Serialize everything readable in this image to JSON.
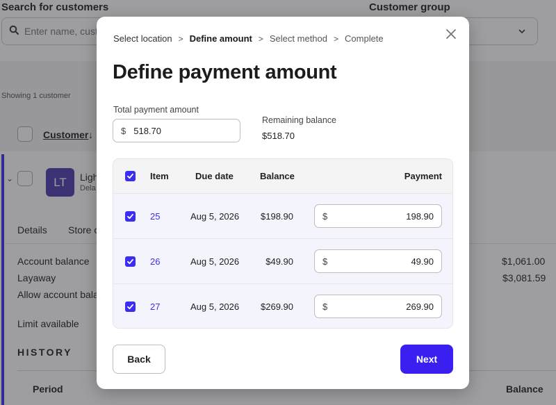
{
  "background": {
    "search_label": "Search for customers",
    "search_placeholder": "Enter name, cust",
    "group_label": "Customer group",
    "showing": "Showing 1 customer",
    "customer_header": "Customer",
    "sort_glyph": "↓",
    "customer": {
      "initials": "LT",
      "name": "Ligh",
      "sub": "Dela",
      "avatar_color": "#4b3bb0"
    },
    "tabs": [
      "Details",
      "Store c"
    ],
    "account_balance_label": "Account balance",
    "account_balance_value": "$1,061.00",
    "layaway_label": "Layaway",
    "layaway_value": "$3,081.59",
    "allow_label": "Allow account bala",
    "limit_label": "Limit available",
    "history_label": "HISTORY",
    "period_label": "Period",
    "balance_label": "Balance"
  },
  "modal": {
    "breadcrumb": [
      "Select location",
      "Define amount",
      "Select method",
      "Complete"
    ],
    "breadcrumb_separator": ">",
    "title": "Define payment amount",
    "total_label": "Total payment amount",
    "currency_symbol": "$",
    "total_value": "518.70",
    "remaining_label": "Remaining balance",
    "remaining_value": "$518.70",
    "columns": {
      "item": "Item",
      "due": "Due date",
      "balance": "Balance",
      "payment": "Payment"
    },
    "rows": [
      {
        "item": "25",
        "due": "Aug 5, 2026",
        "balance": "$198.90",
        "payment": "198.90",
        "checked": true
      },
      {
        "item": "26",
        "due": "Aug 5, 2026",
        "balance": "$49.90",
        "payment": "49.90",
        "checked": true
      },
      {
        "item": "27",
        "due": "Aug 5, 2026",
        "balance": "$269.90",
        "payment": "269.90",
        "checked": true
      }
    ],
    "back_label": "Back",
    "next_label": "Next"
  },
  "colors": {
    "accent": "#3b1ff0",
    "link": "#3b2ef0",
    "row_bg": "#f3f4fc"
  },
  "icons": {
    "close": "close-icon",
    "search": "search-icon",
    "check": "check-icon",
    "chevron": "chevron-down-icon"
  }
}
